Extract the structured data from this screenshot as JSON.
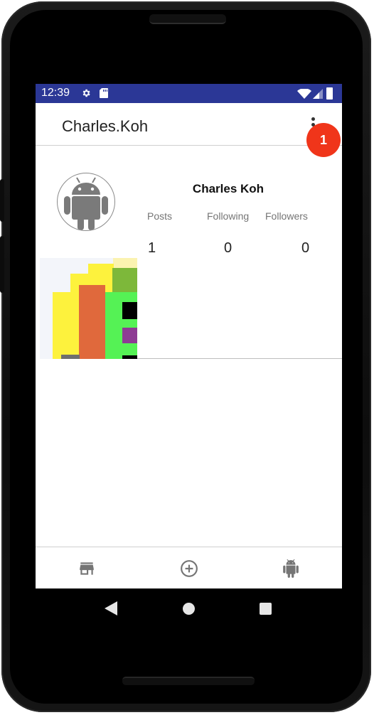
{
  "status_bar": {
    "time": "12:39",
    "icons": [
      "gear-icon",
      "sd-card-icon",
      "wifi-icon",
      "signal-icon",
      "battery-icon"
    ]
  },
  "app_bar": {
    "title": "Charles.Koh",
    "menu_icon": "overflow-menu-icon",
    "notification_badge": "1"
  },
  "profile": {
    "name": "Charles Koh",
    "avatar_icon": "android-avatar-icon",
    "stats": [
      {
        "label": "Posts",
        "value": "1"
      },
      {
        "label": "Following",
        "value": "0"
      },
      {
        "label": "Followers",
        "value": "0"
      }
    ]
  },
  "posts": [
    {
      "thumbnail": "post-thumbnail"
    }
  ],
  "bottom_nav": {
    "items": [
      "store-icon",
      "add-circle-icon",
      "android-icon"
    ]
  },
  "system_nav": {
    "items": [
      "back-icon",
      "home-icon",
      "recents-icon"
    ]
  },
  "colors": {
    "status_bar": "#2b3796",
    "badge": "#f0351a",
    "icon_gray": "#757575"
  }
}
